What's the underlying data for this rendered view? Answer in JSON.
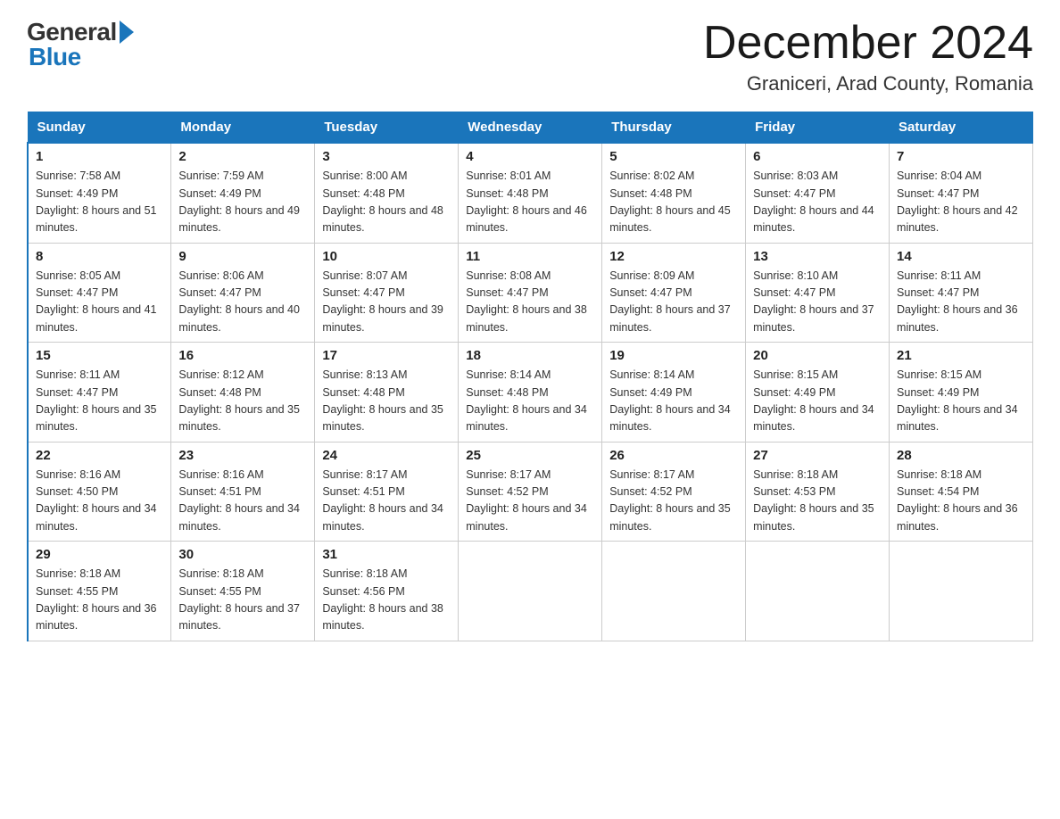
{
  "header": {
    "title": "December 2024",
    "subtitle": "Graniceri, Arad County, Romania",
    "logo_general": "General",
    "logo_blue": "Blue"
  },
  "days_of_week": [
    "Sunday",
    "Monday",
    "Tuesday",
    "Wednesday",
    "Thursday",
    "Friday",
    "Saturday"
  ],
  "weeks": [
    [
      {
        "day": "1",
        "sunrise": "7:58 AM",
        "sunset": "4:49 PM",
        "daylight": "8 hours and 51 minutes."
      },
      {
        "day": "2",
        "sunrise": "7:59 AM",
        "sunset": "4:49 PM",
        "daylight": "8 hours and 49 minutes."
      },
      {
        "day": "3",
        "sunrise": "8:00 AM",
        "sunset": "4:48 PM",
        "daylight": "8 hours and 48 minutes."
      },
      {
        "day": "4",
        "sunrise": "8:01 AM",
        "sunset": "4:48 PM",
        "daylight": "8 hours and 46 minutes."
      },
      {
        "day": "5",
        "sunrise": "8:02 AM",
        "sunset": "4:48 PM",
        "daylight": "8 hours and 45 minutes."
      },
      {
        "day": "6",
        "sunrise": "8:03 AM",
        "sunset": "4:47 PM",
        "daylight": "8 hours and 44 minutes."
      },
      {
        "day": "7",
        "sunrise": "8:04 AM",
        "sunset": "4:47 PM",
        "daylight": "8 hours and 42 minutes."
      }
    ],
    [
      {
        "day": "8",
        "sunrise": "8:05 AM",
        "sunset": "4:47 PM",
        "daylight": "8 hours and 41 minutes."
      },
      {
        "day": "9",
        "sunrise": "8:06 AM",
        "sunset": "4:47 PM",
        "daylight": "8 hours and 40 minutes."
      },
      {
        "day": "10",
        "sunrise": "8:07 AM",
        "sunset": "4:47 PM",
        "daylight": "8 hours and 39 minutes."
      },
      {
        "day": "11",
        "sunrise": "8:08 AM",
        "sunset": "4:47 PM",
        "daylight": "8 hours and 38 minutes."
      },
      {
        "day": "12",
        "sunrise": "8:09 AM",
        "sunset": "4:47 PM",
        "daylight": "8 hours and 37 minutes."
      },
      {
        "day": "13",
        "sunrise": "8:10 AM",
        "sunset": "4:47 PM",
        "daylight": "8 hours and 37 minutes."
      },
      {
        "day": "14",
        "sunrise": "8:11 AM",
        "sunset": "4:47 PM",
        "daylight": "8 hours and 36 minutes."
      }
    ],
    [
      {
        "day": "15",
        "sunrise": "8:11 AM",
        "sunset": "4:47 PM",
        "daylight": "8 hours and 35 minutes."
      },
      {
        "day": "16",
        "sunrise": "8:12 AM",
        "sunset": "4:48 PM",
        "daylight": "8 hours and 35 minutes."
      },
      {
        "day": "17",
        "sunrise": "8:13 AM",
        "sunset": "4:48 PM",
        "daylight": "8 hours and 35 minutes."
      },
      {
        "day": "18",
        "sunrise": "8:14 AM",
        "sunset": "4:48 PM",
        "daylight": "8 hours and 34 minutes."
      },
      {
        "day": "19",
        "sunrise": "8:14 AM",
        "sunset": "4:49 PM",
        "daylight": "8 hours and 34 minutes."
      },
      {
        "day": "20",
        "sunrise": "8:15 AM",
        "sunset": "4:49 PM",
        "daylight": "8 hours and 34 minutes."
      },
      {
        "day": "21",
        "sunrise": "8:15 AM",
        "sunset": "4:49 PM",
        "daylight": "8 hours and 34 minutes."
      }
    ],
    [
      {
        "day": "22",
        "sunrise": "8:16 AM",
        "sunset": "4:50 PM",
        "daylight": "8 hours and 34 minutes."
      },
      {
        "day": "23",
        "sunrise": "8:16 AM",
        "sunset": "4:51 PM",
        "daylight": "8 hours and 34 minutes."
      },
      {
        "day": "24",
        "sunrise": "8:17 AM",
        "sunset": "4:51 PM",
        "daylight": "8 hours and 34 minutes."
      },
      {
        "day": "25",
        "sunrise": "8:17 AM",
        "sunset": "4:52 PM",
        "daylight": "8 hours and 34 minutes."
      },
      {
        "day": "26",
        "sunrise": "8:17 AM",
        "sunset": "4:52 PM",
        "daylight": "8 hours and 35 minutes."
      },
      {
        "day": "27",
        "sunrise": "8:18 AM",
        "sunset": "4:53 PM",
        "daylight": "8 hours and 35 minutes."
      },
      {
        "day": "28",
        "sunrise": "8:18 AM",
        "sunset": "4:54 PM",
        "daylight": "8 hours and 36 minutes."
      }
    ],
    [
      {
        "day": "29",
        "sunrise": "8:18 AM",
        "sunset": "4:55 PM",
        "daylight": "8 hours and 36 minutes."
      },
      {
        "day": "30",
        "sunrise": "8:18 AM",
        "sunset": "4:55 PM",
        "daylight": "8 hours and 37 minutes."
      },
      {
        "day": "31",
        "sunrise": "8:18 AM",
        "sunset": "4:56 PM",
        "daylight": "8 hours and 38 minutes."
      },
      null,
      null,
      null,
      null
    ]
  ]
}
